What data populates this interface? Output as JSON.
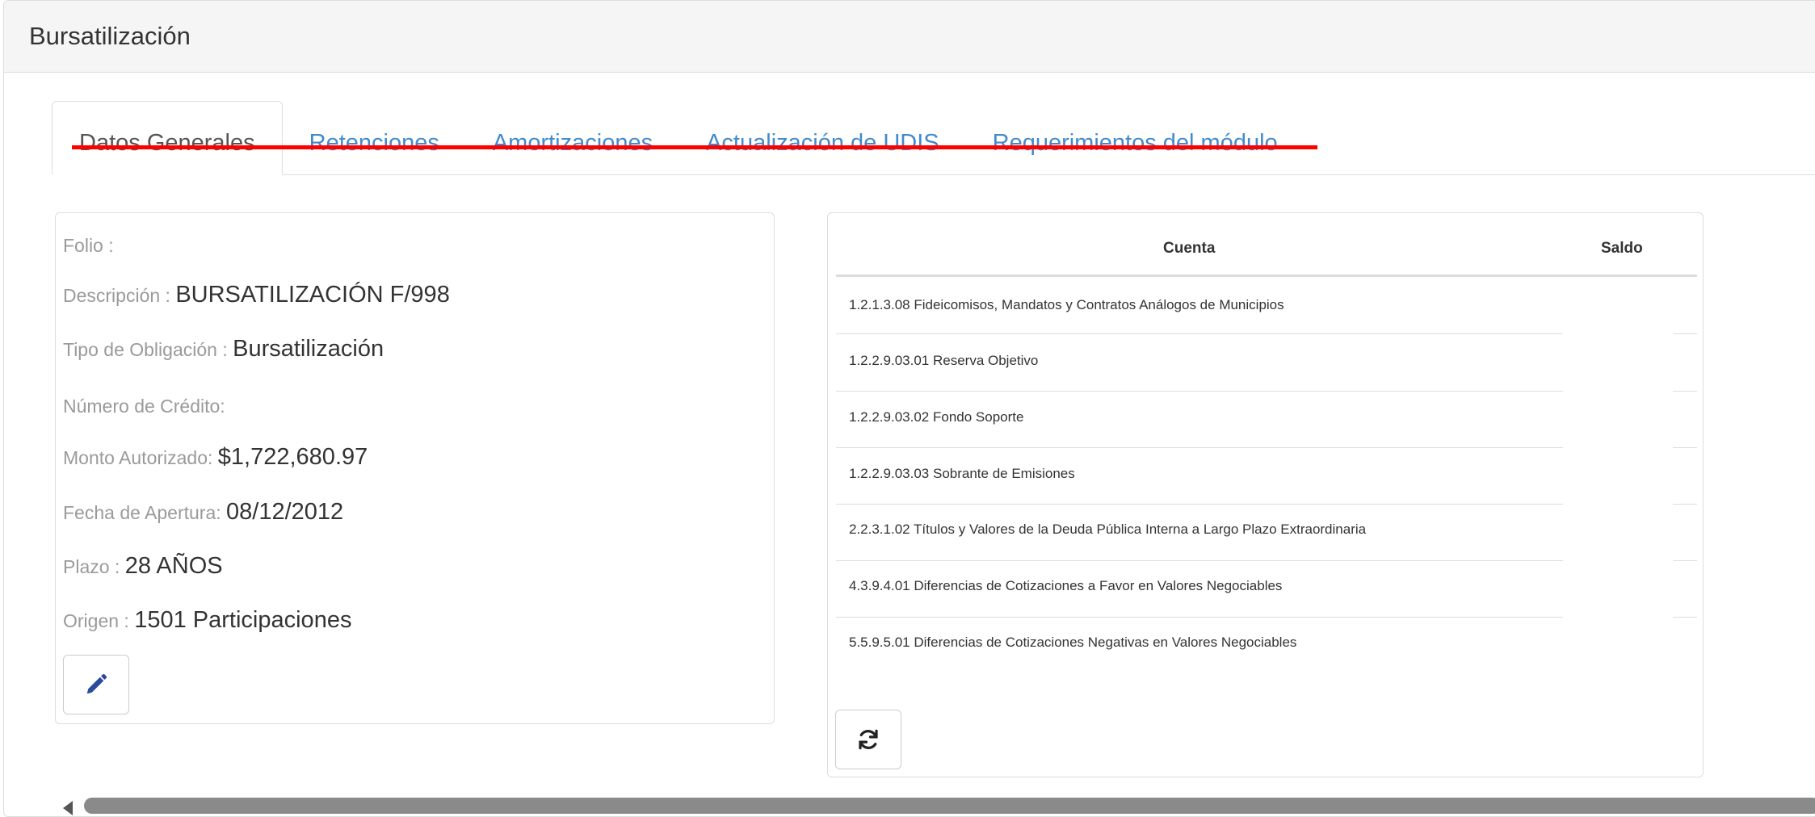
{
  "panel": {
    "title": "Bursatilización"
  },
  "tabs": [
    {
      "label": "Datos Generales"
    },
    {
      "label": "Retenciones"
    },
    {
      "label": "Amortizaciones"
    },
    {
      "label": "Actualización de UDIS"
    },
    {
      "label": "Requerimientos del módulo"
    }
  ],
  "info": {
    "folio_label": "Folio :",
    "folio_value": "",
    "descripcion_label": "Descripción :",
    "descripcion_value": "BURSATILIZACIÓN F/998",
    "tipo_label": "Tipo de Obligación :",
    "tipo_value": "Bursatilización",
    "numero_label": "Número de Crédito:",
    "numero_value": "",
    "monto_label": "Monto Autorizado:",
    "monto_value": "$1,722,680.97",
    "fecha_label": "Fecha de Apertura:",
    "fecha_value": "08/12/2012",
    "plazo_label": "Plazo :",
    "plazo_value": "28 AÑOS",
    "origen_label": "Origen :",
    "origen_value": "1501 Participaciones"
  },
  "table": {
    "headers": {
      "cuenta": "Cuenta",
      "saldo": "Saldo"
    },
    "rows": [
      {
        "cuenta": "1.2.1.3.08 Fideicomisos, Mandatos y Contratos Análogos de Municipios",
        "saldo": ""
      },
      {
        "cuenta": "1.2.2.9.03.01 Reserva Objetivo",
        "saldo": ""
      },
      {
        "cuenta": "1.2.2.9.03.02 Fondo Soporte",
        "saldo": ""
      },
      {
        "cuenta": "1.2.2.9.03.03 Sobrante de Emisiones",
        "saldo": ""
      },
      {
        "cuenta": "2.2.3.1.02 Títulos y Valores de la Deuda Pública Interna a Largo Plazo Extraordinaria",
        "saldo": ""
      },
      {
        "cuenta": "4.3.9.4.01 Diferencias de Cotizaciones a Favor en Valores Negociables",
        "saldo": ""
      },
      {
        "cuenta": "5.5.9.5.01 Diferencias de Cotizaciones Negativas en Valores Negociables",
        "saldo": ""
      }
    ]
  },
  "icons": {
    "edit": "pencil-icon",
    "refresh": "refresh-icon"
  },
  "colors": {
    "link": "#428bca",
    "annotation": "#ff0000",
    "edit_icon": "#2c4a9e"
  }
}
